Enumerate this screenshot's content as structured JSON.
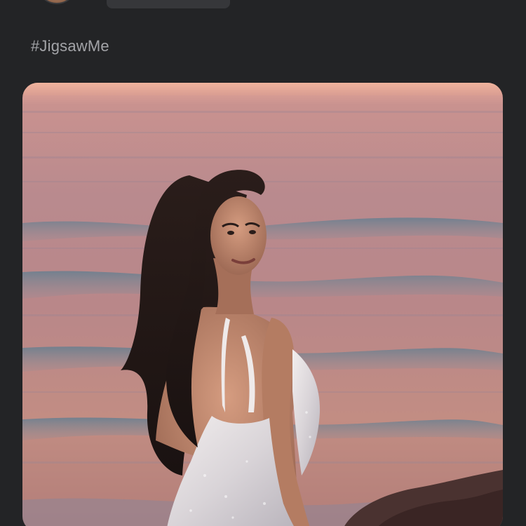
{
  "post": {
    "hashtag": "#JigsawMe",
    "image_subject": "photo"
  },
  "colors": {
    "background": "#232426",
    "hashtag_text": "#a3a4a8",
    "placeholder_pill": "#36373a"
  }
}
